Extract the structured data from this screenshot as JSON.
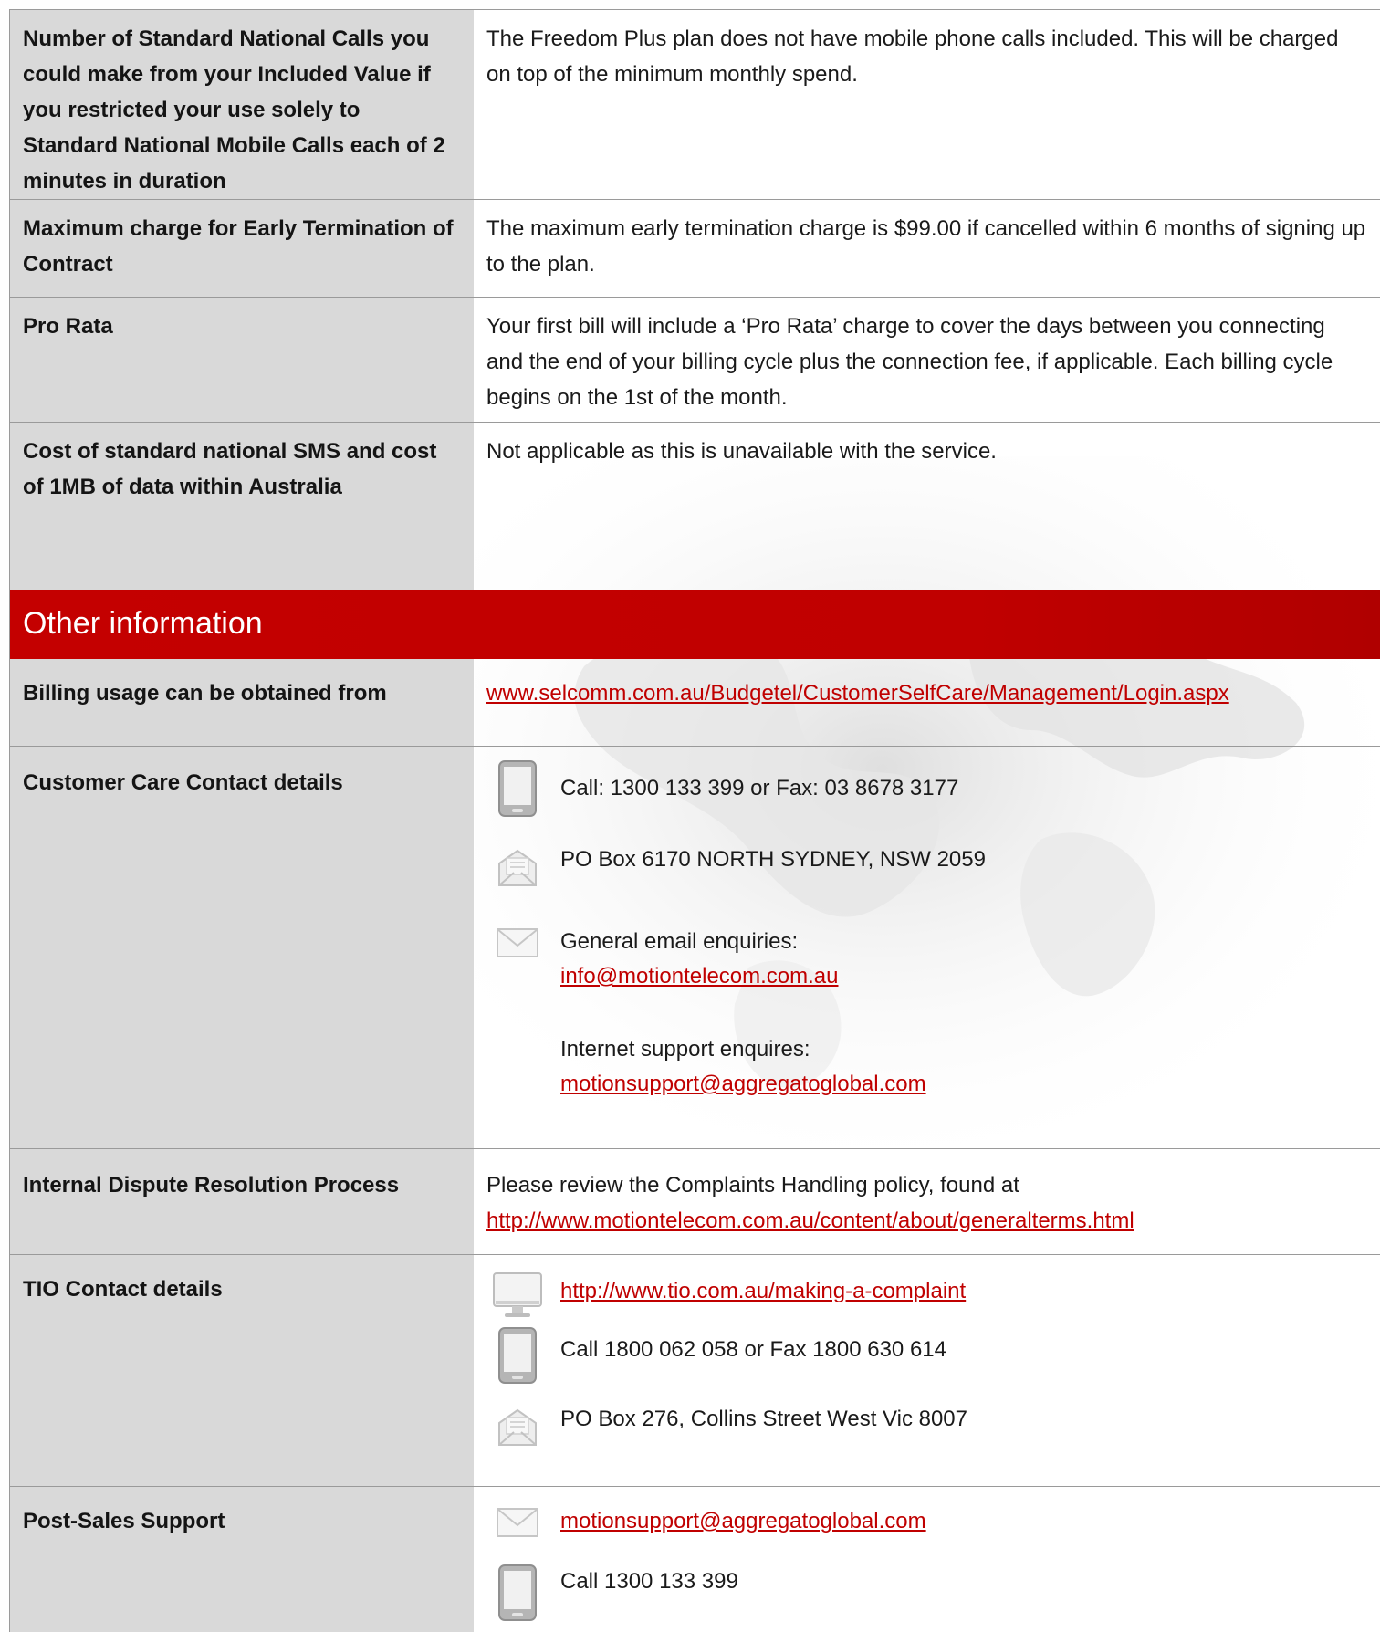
{
  "rows": [
    {
      "label": "Number of Standard National Calls you could make from your Included Value if you restricted your use solely to Standard National Mobile Calls each of 2 minutes in duration",
      "value": "The Freedom Plus plan does not have mobile phone calls included. This will be charged on top of the minimum monthly spend."
    },
    {
      "label": "Maximum charge for Early Termination of Contract",
      "value": "The maximum early termination charge is $99.00 if cancelled within 6 months of signing up to the plan."
    },
    {
      "label": "Pro Rata",
      "value": "Your first bill will include a ‘Pro Rata’ charge to cover the days between you connecting and the end of your billing cycle plus the connection fee, if applicable. Each billing cycle begins on the 1st of the month."
    },
    {
      "label": "Cost of standard national SMS and cost of 1MB of data within Australia",
      "value": "Not applicable as this is unavailable with the service."
    }
  ],
  "section": {
    "title": "Other information"
  },
  "other": {
    "billing": {
      "label": "Billing usage can be obtained from",
      "link": "www.selcomm.com.au/Budgetel/CustomerSelfCare/Management/Login.aspx"
    },
    "customer_care": {
      "label": "Customer Care Contact details",
      "phone": "Call: 1300 133 399 or Fax: 03 8678 3177",
      "post": "PO Box 6170 NORTH SYDNEY, NSW 2059",
      "email_label": "General email enquiries:",
      "email_link": "info@motiontelecom.com.au",
      "internet_label": "Internet support enquires:",
      "internet_link": "motionsupport@aggregatoglobal.com"
    },
    "dispute": {
      "label": "Internal Dispute Resolution Process",
      "text": "Please review the Complaints Handling policy, found at",
      "link": "http://www.motiontelecom.com.au/content/about/generalterms.html"
    },
    "tio": {
      "label": "TIO Contact details",
      "web": "http://www.tio.com.au/making-a-complaint",
      "phone": "Call 1800 062 058 or Fax 1800 630 614",
      "post": "PO Box 276, Collins Street West Vic 8007"
    },
    "post_sales": {
      "label": "Post-Sales Support",
      "email": "motionsupport@aggregatoglobal.com",
      "phone": "Call 1300 133 399"
    }
  },
  "icons": {
    "phone": "mobile-phone-icon",
    "post": "mail-letter-icon",
    "email": "envelope-icon",
    "web": "computer-monitor-icon"
  },
  "colors": {
    "accent": "#c00000",
    "label_bg": "#d9d9d9",
    "border": "#9a9a9a"
  }
}
